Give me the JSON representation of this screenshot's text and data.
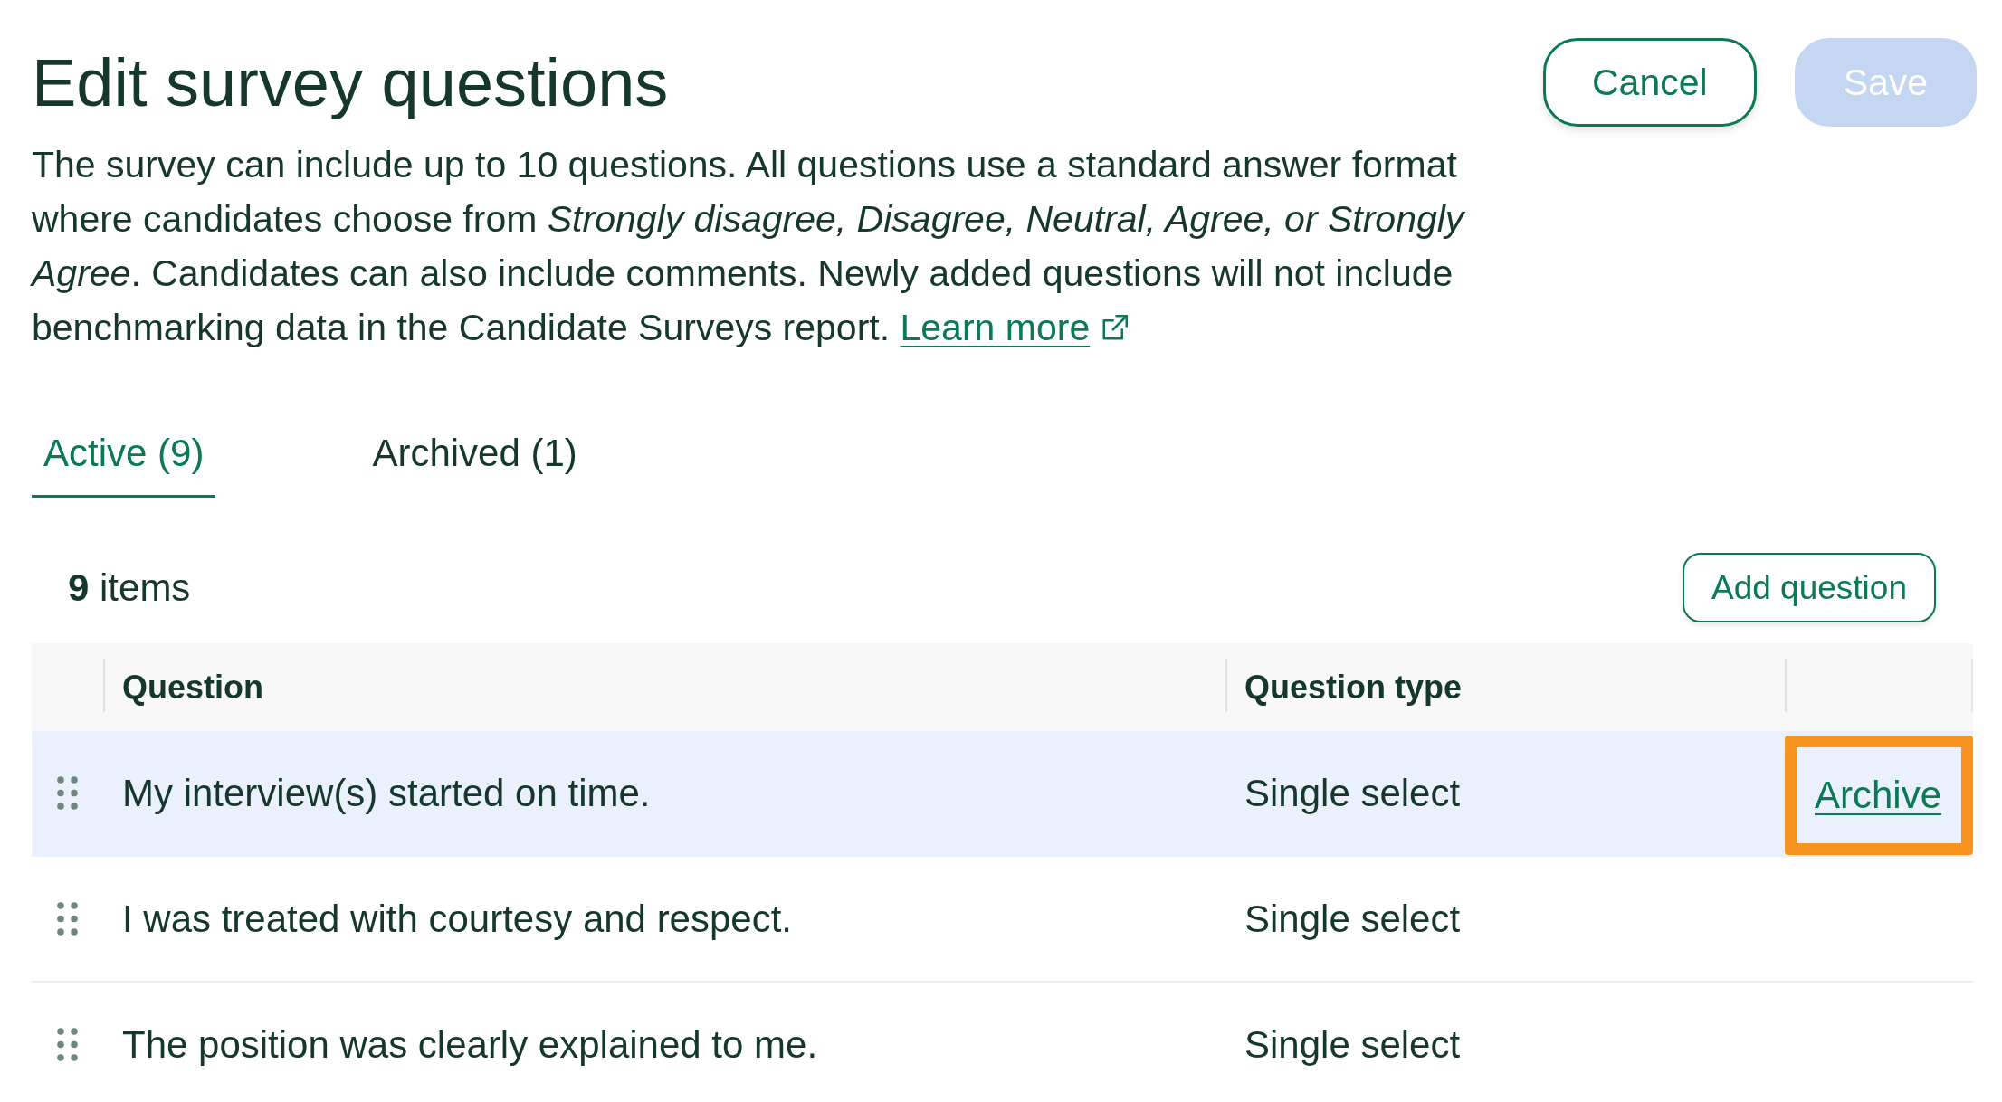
{
  "title": "Edit survey questions",
  "buttons": [
    {
      "label": "Cancel",
      "kind": "secondary",
      "disabled": false
    },
    {
      "label": "Save",
      "kind": "primary",
      "disabled": true
    }
  ],
  "description": {
    "text": "The survey can include up to 10 questions. All questions use a standard answer format where candidates choose from *Strongly disagree, Disagree, Neutral, Agree, or Strongly Agree*. Candidates can also include comments. Newly added questions will not include benchmarking data in the Candidate Surveys report.",
    "link": "Learn more"
  },
  "tabs": [
    {
      "label": "Active (9)",
      "selected": true
    },
    {
      "label": "Archived (1)",
      "selected": false
    }
  ],
  "toolbar": {
    "count": "**9** items",
    "add_button": "Add question"
  },
  "table": {
    "columns": [
      "Question",
      "Question type"
    ],
    "rows": [
      {
        "question": "My interview(s) started on time.",
        "type": "Single select",
        "hovered": true,
        "action": "Archive",
        "annotated": true
      },
      {
        "question": "I was treated with courtesy and respect.",
        "type": "Single select",
        "hovered": false,
        "annotated": false
      },
      {
        "question": "The position was clearly explained to me.",
        "type": "Single select",
        "hovered": false,
        "annotated": false
      }
    ]
  }
}
